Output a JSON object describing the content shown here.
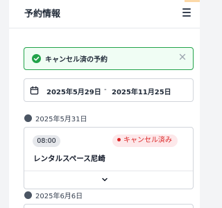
{
  "header": {
    "title": "予約情報"
  },
  "alert": {
    "message": "キャンセル済の予約"
  },
  "date_range": {
    "start": "2025年5月29日",
    "separator": "-",
    "end": "2025年11月25日"
  },
  "groups": [
    {
      "date": "2025年5月31日",
      "reservations": [
        {
          "time": "08:00",
          "status": "キャンセル済み",
          "venue": "レンタルスペース尼崎"
        }
      ]
    },
    {
      "date": "2025年6月6日"
    }
  ],
  "colors": {
    "success": "#22a34a",
    "cancel_status": "#dc2626",
    "cancel_badge_bg": "#fde8ea"
  }
}
